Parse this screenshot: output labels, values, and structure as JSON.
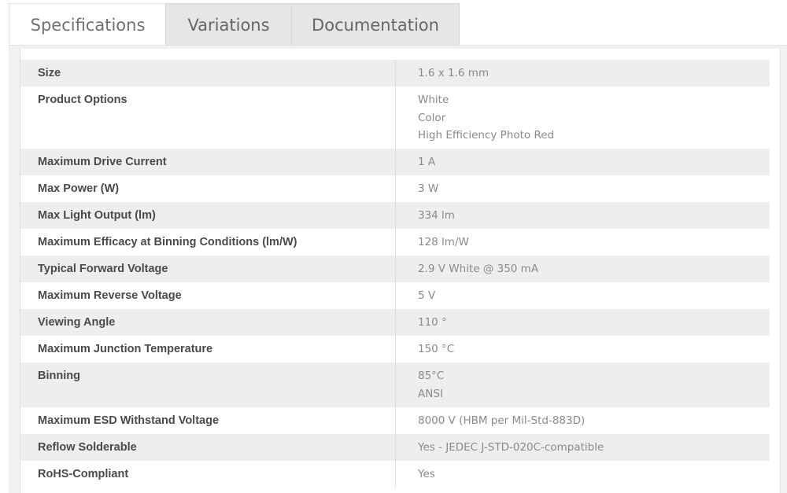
{
  "tabs": [
    {
      "label": "Specifications",
      "active": true
    },
    {
      "label": "Variations",
      "active": false
    },
    {
      "label": "Documentation",
      "active": false
    }
  ],
  "specs": [
    {
      "label": "Size",
      "values": [
        "1.6 x 1.6 mm"
      ]
    },
    {
      "label": "Product Options",
      "values": [
        "White",
        "Color",
        "High Efficiency Photo Red"
      ]
    },
    {
      "label": "Maximum Drive Current",
      "values": [
        "1 A"
      ]
    },
    {
      "label": "Max Power (W)",
      "values": [
        "3 W"
      ]
    },
    {
      "label": "Max Light Output (lm)",
      "values": [
        "334 lm"
      ]
    },
    {
      "label": "Maximum Efficacy at Binning Conditions (lm/W)",
      "values": [
        "128 lm/W"
      ]
    },
    {
      "label": "Typical Forward Voltage",
      "values": [
        "2.9 V White @ 350 mA"
      ]
    },
    {
      "label": "Maximum Reverse Voltage",
      "values": [
        "5 V"
      ]
    },
    {
      "label": "Viewing Angle",
      "values": [
        "110 °"
      ]
    },
    {
      "label": "Maximum Junction Temperature",
      "values": [
        "150 °C"
      ]
    },
    {
      "label": "Binning",
      "values": [
        "85°C",
        "ANSI"
      ]
    },
    {
      "label": "Maximum ESD Withstand Voltage",
      "values": [
        "8000 V (HBM per Mil-Std-883D)"
      ]
    },
    {
      "label": "Reflow Solderable",
      "values": [
        "Yes - JEDEC J-STD-020C-compatible"
      ]
    },
    {
      "label": "RoHS-Compliant",
      "values": [
        "Yes"
      ]
    }
  ]
}
